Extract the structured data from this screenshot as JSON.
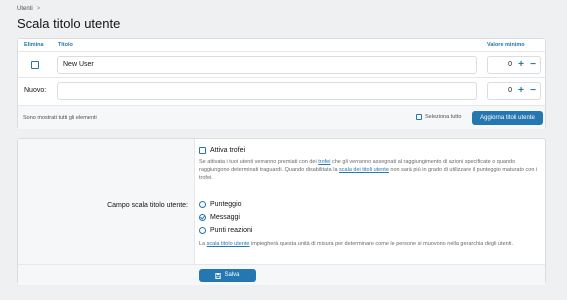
{
  "breadcrumb": {
    "items": [
      "Utenti"
    ],
    "separator": ">"
  },
  "page_title": "Scala titolo utente",
  "table": {
    "headers": {
      "delete": "Elimina",
      "title": "Titolo",
      "min_value": "Valore minimo"
    },
    "rows": [
      {
        "title": "New User",
        "min_value": "0"
      }
    ],
    "new_row": {
      "label": "Nuovo:",
      "min_value": "0"
    },
    "plus": "+",
    "minus": "−"
  },
  "footer": {
    "note": "Sono mostrati tutti gli elementi",
    "select_all": "Seleziona tutto",
    "update_button": "Aggiorna titoli utente"
  },
  "settings": {
    "trophies_label": "Attiva trofei",
    "trophies_help_1": "Se attivata i tuoi utenti verranno premiati con dei ",
    "trophies_link": "trofei",
    "trophies_help_2": " che gli verranno assegnati al raggiungimento di azioni specificate o quando raggiungono determinati traguardi. Quando disabilitata la ",
    "trophies_link_2": "scala dei titoli utente",
    "trophies_help_3": " non sarà più in grado di utilizzare il punteggio maturato con i trofei.",
    "field_label": "Campo scala titolo utente:",
    "options": [
      {
        "label": "Punteggio",
        "checked": false
      },
      {
        "label": "Messaggi",
        "checked": true
      },
      {
        "label": "Punti reazioni",
        "checked": false
      }
    ],
    "ladder_help_1": "La ",
    "ladder_link": "scala titolo utente",
    "ladder_help_2": " impiegherà questa unità di misura per determinare come le persone si muovono nella gerarchia degli utenti.",
    "save_button": "Salva"
  },
  "colors": {
    "accent": "#2577b1",
    "background": "#eef0f2",
    "panel": "#ffffff"
  }
}
